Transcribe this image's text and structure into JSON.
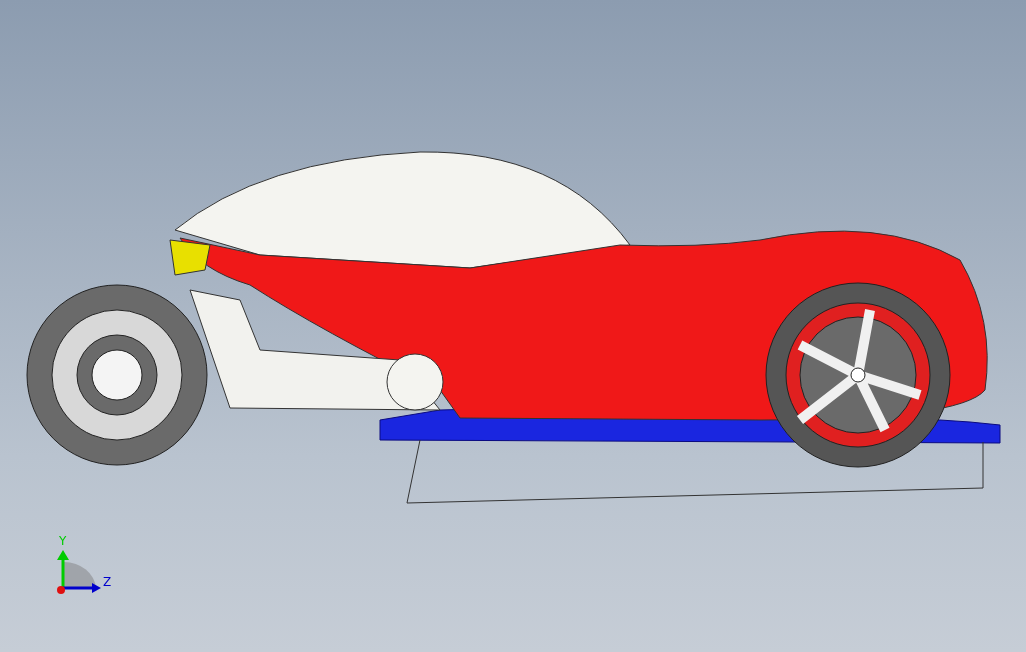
{
  "viewport": {
    "triad": {
      "axes": [
        {
          "kind": "vertical",
          "label": "Y",
          "color": "#00cc00"
        },
        {
          "kind": "horizontal",
          "label": "Z",
          "color": "#0000cc"
        }
      ]
    }
  }
}
